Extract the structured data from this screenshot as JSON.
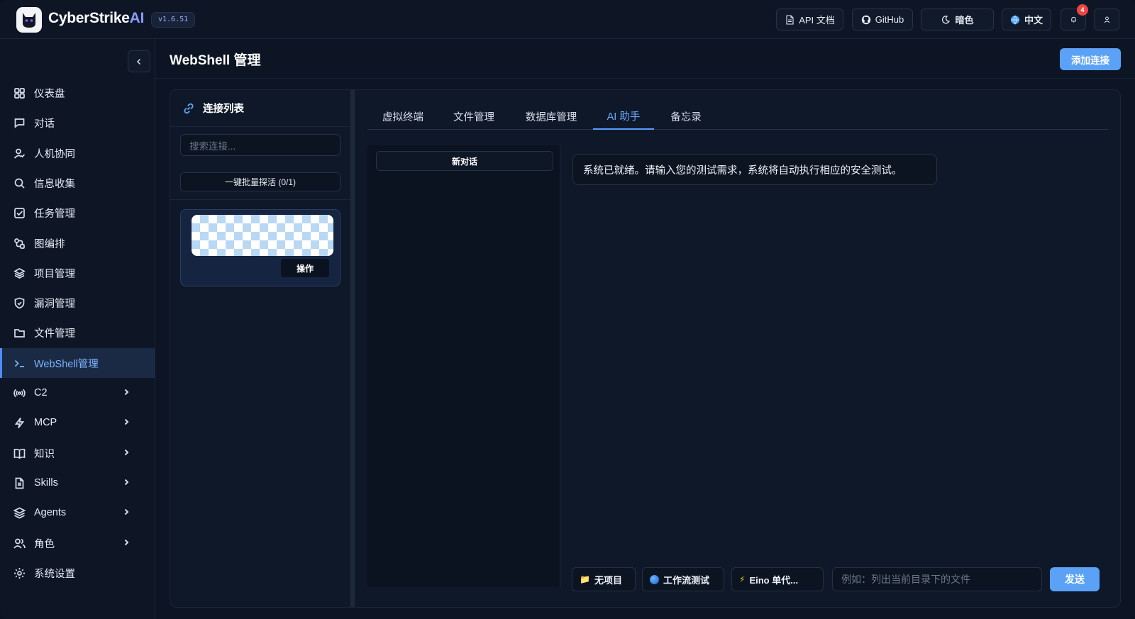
{
  "app": {
    "brand_main": "CyberStrike",
    "brand_accent": "AI",
    "version": "v1.6.51"
  },
  "topbar": {
    "api_docs": "API 文档",
    "github": "GitHub",
    "theme": "暗色",
    "language": "中文",
    "notification_count": "4"
  },
  "sidebar": {
    "items": [
      {
        "label": "仪表盘",
        "icon": "dashboard-icon"
      },
      {
        "label": "对话",
        "icon": "chat-icon"
      },
      {
        "label": "人机协同",
        "icon": "user-check-icon"
      },
      {
        "label": "信息收集",
        "icon": "search-icon"
      },
      {
        "label": "任务管理",
        "icon": "task-icon"
      },
      {
        "label": "图编排",
        "icon": "workflow-icon"
      },
      {
        "label": "项目管理",
        "icon": "layers-icon"
      },
      {
        "label": "漏洞管理",
        "icon": "shield-icon"
      },
      {
        "label": "文件管理",
        "icon": "folder-icon"
      },
      {
        "label": "WebShell管理",
        "icon": "terminal-icon",
        "active": true
      },
      {
        "label": "C2",
        "icon": "broadcast-icon",
        "expandable": true
      },
      {
        "label": "MCP",
        "icon": "bolt-icon",
        "expandable": true
      },
      {
        "label": "知识",
        "icon": "book-icon",
        "expandable": true
      },
      {
        "label": "Skills",
        "icon": "document-icon",
        "expandable": true
      },
      {
        "label": "Agents",
        "icon": "stack-icon",
        "expandable": true
      },
      {
        "label": "角色",
        "icon": "users-icon",
        "expandable": true
      },
      {
        "label": "系统设置",
        "icon": "gear-icon"
      }
    ]
  },
  "main": {
    "title": "WebShell 管理",
    "add_button": "添加连接"
  },
  "connections": {
    "title": "连接列表",
    "search_placeholder": "搜索连接...",
    "batch_button": "一键批量探活 (0/1)",
    "ops_button": "操作"
  },
  "tabs": [
    {
      "label": "虚拟终端"
    },
    {
      "label": "文件管理"
    },
    {
      "label": "数据库管理"
    },
    {
      "label": "AI 助手",
      "active": true
    },
    {
      "label": "备忘录"
    }
  ],
  "assistant": {
    "new_conversation": "新对话",
    "message": "系统已就绪。请输入您的测试需求，系统将自动执行相应的安全测试。",
    "chip_project": "无项目",
    "chip_workflow": "工作流测试",
    "chip_agent": "Eino 单代...",
    "input_placeholder": "例如：列出当前目录下的文件",
    "send": "发送"
  },
  "colors": {
    "accent": "#5ba2f7",
    "active_text": "#7ab4ff",
    "background": "#0d1524"
  }
}
